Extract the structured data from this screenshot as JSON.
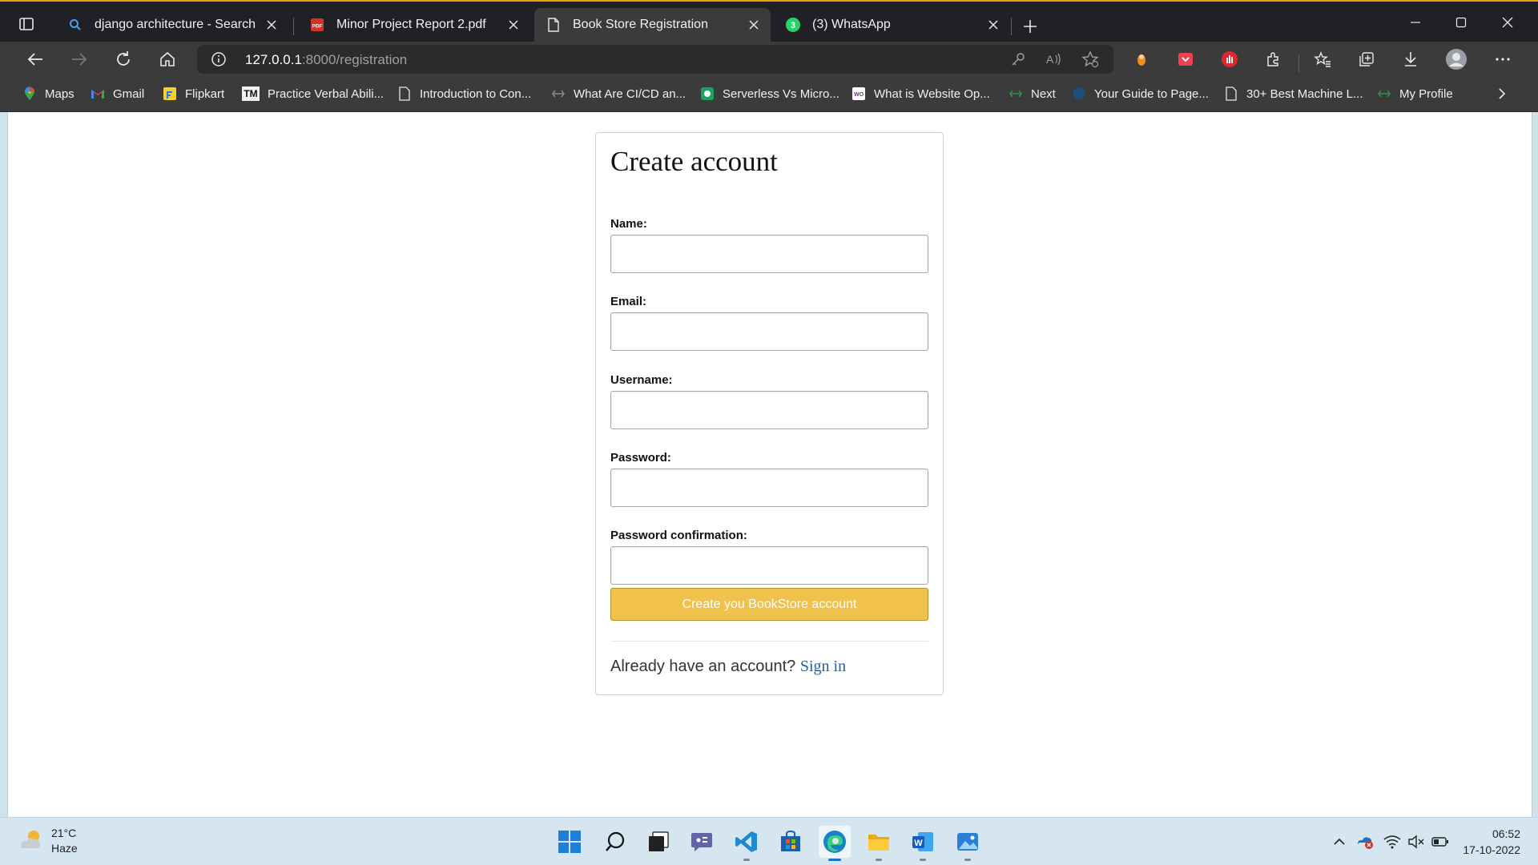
{
  "browser": {
    "tabs": [
      {
        "title": "django architecture - Search",
        "icon": "search-icon"
      },
      {
        "title": "Minor Project Report 2.pdf",
        "icon": "pdf-icon"
      },
      {
        "title": "Book Store Registration",
        "icon": "page-icon",
        "active": true
      },
      {
        "title": "(3) WhatsApp",
        "icon": "whatsapp-icon",
        "badge": "3"
      }
    ],
    "address": {
      "host": "127.0.0.1",
      "rest": ":8000/registration"
    },
    "bookmarks": [
      {
        "label": "Maps",
        "icon": "maps-icon"
      },
      {
        "label": "Gmail",
        "icon": "gmail-icon"
      },
      {
        "label": "Flipkart",
        "icon": "flipkart-icon"
      },
      {
        "label": "Practice Verbal Abili...",
        "icon": "tm-icon",
        "icon_text": "TM"
      },
      {
        "label": "Introduction to Con...",
        "icon": "page-icon"
      },
      {
        "label": "What Are CI/CD an...",
        "icon": "link-icon"
      },
      {
        "label": "Serverless Vs Micro...",
        "icon": "site-icon"
      },
      {
        "label": "What is Website Op...",
        "icon": "site-icon"
      },
      {
        "label": "Next",
        "icon": "link-icon"
      },
      {
        "label": "Your Guide to Page...",
        "icon": "shield-icon"
      },
      {
        "label": "30+ Best Machine L...",
        "icon": "page-icon"
      },
      {
        "label": "My Profile",
        "icon": "link-icon"
      }
    ]
  },
  "page": {
    "title": "Create account",
    "fields": [
      {
        "label": "Name:",
        "value": ""
      },
      {
        "label": "Email:",
        "value": ""
      },
      {
        "label": "Username:",
        "value": ""
      },
      {
        "label": "Password:",
        "value": ""
      },
      {
        "label": "Password confirmation:",
        "value": ""
      }
    ],
    "submit_label": "Create you BookStore account",
    "already_text": "Already have an account?",
    "signin_label": "Sign in",
    "accent_color": "#f0c14b",
    "link_color": "#1f5fa6"
  },
  "taskbar": {
    "weather": {
      "temp": "21°C",
      "condition": "Haze"
    },
    "apps": [
      "start-icon",
      "search-icon",
      "task-view-icon",
      "teams-chat-icon",
      "vscode-icon",
      "store-icon",
      "edge-icon",
      "file-explorer-icon",
      "word-icon",
      "photos-icon"
    ],
    "clock": {
      "time": "06:52",
      "date": "17-10-2022"
    }
  }
}
